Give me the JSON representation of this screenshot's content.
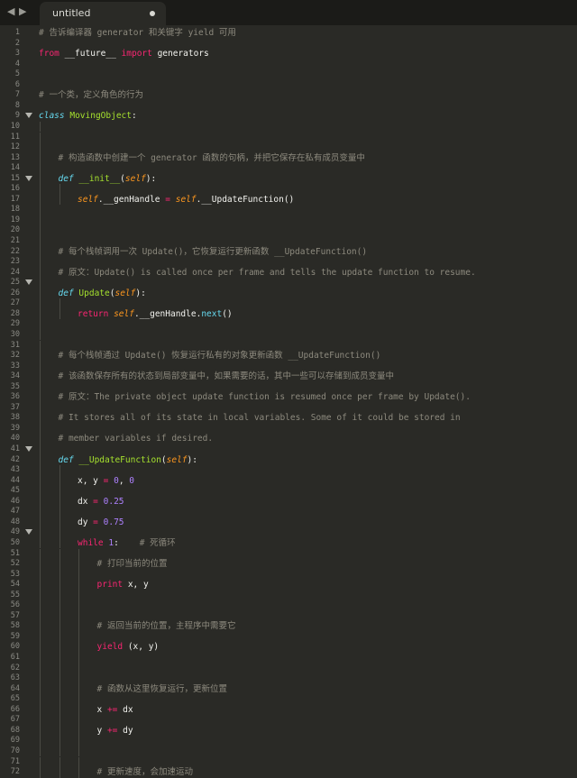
{
  "titlebar": {
    "nav_back": "◀",
    "nav_forward": "▶"
  },
  "tab": {
    "title": "untitled",
    "modified": true
  },
  "editor": {
    "first_line": 1,
    "fold_lines": [
      9,
      15,
      25,
      41,
      49
    ],
    "lines": [
      {
        "indent": 0,
        "segments": [
          [
            "comment",
            "# 告诉编译器 generator 和关键字 yield 可用"
          ]
        ]
      },
      {
        "indent": 0,
        "segments": []
      },
      {
        "indent": 0,
        "segments": [
          [
            "keyword",
            "from"
          ],
          [
            "plain",
            " __future__ "
          ],
          [
            "keyword",
            "import"
          ],
          [
            "plain",
            " generators"
          ]
        ]
      },
      {
        "indent": 0,
        "segments": []
      },
      {
        "indent": 0,
        "segments": []
      },
      {
        "indent": 0,
        "segments": []
      },
      {
        "indent": 0,
        "segments": [
          [
            "comment",
            "# 一个类，定义角色的行为"
          ]
        ]
      },
      {
        "indent": 0,
        "segments": []
      },
      {
        "indent": 0,
        "segments": [
          [
            "defkw",
            "class"
          ],
          [
            "plain",
            " "
          ],
          [
            "classname",
            "MovingObject"
          ],
          [
            "plain",
            ":"
          ]
        ]
      },
      {
        "indent": 1,
        "segments": []
      },
      {
        "indent": 1,
        "segments": []
      },
      {
        "indent": 1,
        "segments": []
      },
      {
        "indent": 1,
        "segments": [
          [
            "comment",
            "# 构造函数中创建一个 generator 函数的句柄，并把它保存在私有成员变量中"
          ]
        ]
      },
      {
        "indent": 1,
        "segments": []
      },
      {
        "indent": 1,
        "segments": [
          [
            "defkw",
            "def"
          ],
          [
            "plain",
            " "
          ],
          [
            "func",
            "__init__"
          ],
          [
            "plain",
            "("
          ],
          [
            "self",
            "self"
          ],
          [
            "plain",
            "):"
          ]
        ]
      },
      {
        "indent": 2,
        "segments": []
      },
      {
        "indent": 2,
        "segments": [
          [
            "self",
            "self"
          ],
          [
            "plain",
            ".__genHandle "
          ],
          [
            "op",
            "="
          ],
          [
            "plain",
            " "
          ],
          [
            "self",
            "self"
          ],
          [
            "plain",
            ".__UpdateFunction()"
          ]
        ]
      },
      {
        "indent": 1,
        "segments": []
      },
      {
        "indent": 1,
        "segments": []
      },
      {
        "indent": 1,
        "segments": []
      },
      {
        "indent": 1,
        "segments": []
      },
      {
        "indent": 1,
        "segments": [
          [
            "comment",
            "# 每个栈帧调用一次 Update()，它恢复运行更新函数 __UpdateFunction()"
          ]
        ]
      },
      {
        "indent": 1,
        "segments": []
      },
      {
        "indent": 1,
        "segments": [
          [
            "comment",
            "# 原文：Update() is called once per frame and tells the update function to resume."
          ]
        ]
      },
      {
        "indent": 1,
        "segments": []
      },
      {
        "indent": 1,
        "segments": [
          [
            "defkw",
            "def"
          ],
          [
            "plain",
            " "
          ],
          [
            "func",
            "Update"
          ],
          [
            "plain",
            "("
          ],
          [
            "self",
            "self"
          ],
          [
            "plain",
            "):"
          ]
        ]
      },
      {
        "indent": 2,
        "segments": []
      },
      {
        "indent": 2,
        "segments": [
          [
            "keyword",
            "return"
          ],
          [
            "plain",
            " "
          ],
          [
            "self",
            "self"
          ],
          [
            "plain",
            ".__genHandle."
          ],
          [
            "builtin",
            "next"
          ],
          [
            "plain",
            "()"
          ]
        ]
      },
      {
        "indent": 1,
        "segments": []
      },
      {
        "indent": 1,
        "segments": []
      },
      {
        "indent": 1,
        "segments": []
      },
      {
        "indent": 1,
        "segments": [
          [
            "comment",
            "# 每个栈帧通过 Update() 恢复运行私有的对象更新函数 __UpdateFunction()"
          ]
        ]
      },
      {
        "indent": 1,
        "segments": []
      },
      {
        "indent": 1,
        "segments": [
          [
            "comment",
            "# 该函数保存所有的状态到局部变量中，如果需要的话，其中一些可以存储到成员变量中"
          ]
        ]
      },
      {
        "indent": 1,
        "segments": []
      },
      {
        "indent": 1,
        "segments": [
          [
            "comment",
            "# 原文：The private object update function is resumed once per frame by Update()."
          ]
        ]
      },
      {
        "indent": 1,
        "segments": []
      },
      {
        "indent": 1,
        "segments": [
          [
            "comment",
            "# It stores all of its state in local variables. Some of it could be stored in"
          ]
        ]
      },
      {
        "indent": 1,
        "segments": []
      },
      {
        "indent": 1,
        "segments": [
          [
            "comment",
            "# member variables if desired."
          ]
        ]
      },
      {
        "indent": 1,
        "segments": []
      },
      {
        "indent": 1,
        "segments": [
          [
            "defkw",
            "def"
          ],
          [
            "plain",
            " "
          ],
          [
            "func",
            "__UpdateFunction"
          ],
          [
            "plain",
            "("
          ],
          [
            "self",
            "self"
          ],
          [
            "plain",
            "):"
          ]
        ]
      },
      {
        "indent": 2,
        "segments": []
      },
      {
        "indent": 2,
        "segments": [
          [
            "plain",
            "x, y "
          ],
          [
            "op",
            "="
          ],
          [
            "plain",
            " "
          ],
          [
            "num",
            "0"
          ],
          [
            "plain",
            ", "
          ],
          [
            "num",
            "0"
          ]
        ]
      },
      {
        "indent": 2,
        "segments": []
      },
      {
        "indent": 2,
        "segments": [
          [
            "plain",
            "dx "
          ],
          [
            "op",
            "="
          ],
          [
            "plain",
            " "
          ],
          [
            "num",
            "0.25"
          ]
        ]
      },
      {
        "indent": 2,
        "segments": []
      },
      {
        "indent": 2,
        "segments": [
          [
            "plain",
            "dy "
          ],
          [
            "op",
            "="
          ],
          [
            "plain",
            " "
          ],
          [
            "num",
            "0.75"
          ]
        ]
      },
      {
        "indent": 2,
        "segments": []
      },
      {
        "indent": 2,
        "segments": [
          [
            "keyword",
            "while"
          ],
          [
            "plain",
            " "
          ],
          [
            "num",
            "1"
          ],
          [
            "plain",
            ":    "
          ],
          [
            "comment",
            "# 死循环"
          ]
        ]
      },
      {
        "indent": 3,
        "segments": []
      },
      {
        "indent": 3,
        "segments": [
          [
            "comment",
            "# 打印当前的位置"
          ]
        ]
      },
      {
        "indent": 3,
        "segments": []
      },
      {
        "indent": 3,
        "segments": [
          [
            "keyword",
            "print"
          ],
          [
            "plain",
            " x, y"
          ]
        ]
      },
      {
        "indent": 3,
        "segments": []
      },
      {
        "indent": 3,
        "segments": []
      },
      {
        "indent": 3,
        "segments": []
      },
      {
        "indent": 3,
        "segments": [
          [
            "comment",
            "# 返回当前的位置，主程序中需要它"
          ]
        ]
      },
      {
        "indent": 3,
        "segments": []
      },
      {
        "indent": 3,
        "segments": [
          [
            "keyword",
            "yield"
          ],
          [
            "plain",
            " (x, y)"
          ]
        ]
      },
      {
        "indent": 3,
        "segments": []
      },
      {
        "indent": 3,
        "segments": []
      },
      {
        "indent": 3,
        "segments": []
      },
      {
        "indent": 3,
        "segments": [
          [
            "comment",
            "# 函数从这里恢复运行，更新位置"
          ]
        ]
      },
      {
        "indent": 3,
        "segments": []
      },
      {
        "indent": 3,
        "segments": [
          [
            "plain",
            "x "
          ],
          [
            "op",
            "+="
          ],
          [
            "plain",
            " dx"
          ]
        ]
      },
      {
        "indent": 3,
        "segments": []
      },
      {
        "indent": 3,
        "segments": [
          [
            "plain",
            "y "
          ],
          [
            "op",
            "+="
          ],
          [
            "plain",
            " dy"
          ]
        ]
      },
      {
        "indent": 3,
        "segments": []
      },
      {
        "indent": 3,
        "segments": []
      },
      {
        "indent": 3,
        "segments": []
      },
      {
        "indent": 3,
        "segments": [
          [
            "comment",
            "# 更新速度，会加速运动"
          ]
        ]
      }
    ]
  }
}
